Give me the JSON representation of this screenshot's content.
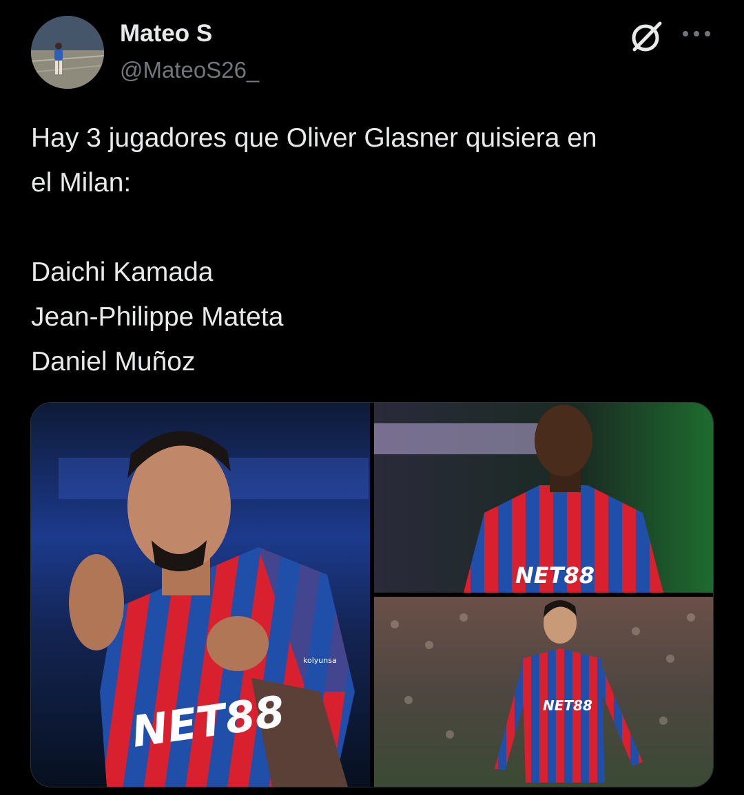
{
  "author": {
    "display_name": "Mateo S",
    "handle": "@MateoS26_"
  },
  "header_icons": {
    "grok": "grok-icon",
    "more": "more-options-icon"
  },
  "tweet": {
    "line1": "Hay 3 jugadores que Oliver Glasner quisiera en",
    "line2": "el Milan:",
    "players": [
      "Daichi Kamada",
      "Jean-Philippe Mateta",
      "Daniel Muñoz"
    ]
  },
  "media": {
    "sponsor": "NET88",
    "badge_text": "kolyunsa"
  },
  "colors": {
    "background": "#000000",
    "text_primary": "#e7e9ea",
    "text_secondary": "#71767b",
    "kit_red": "#d8202f",
    "kit_blue": "#1f4fa8"
  }
}
